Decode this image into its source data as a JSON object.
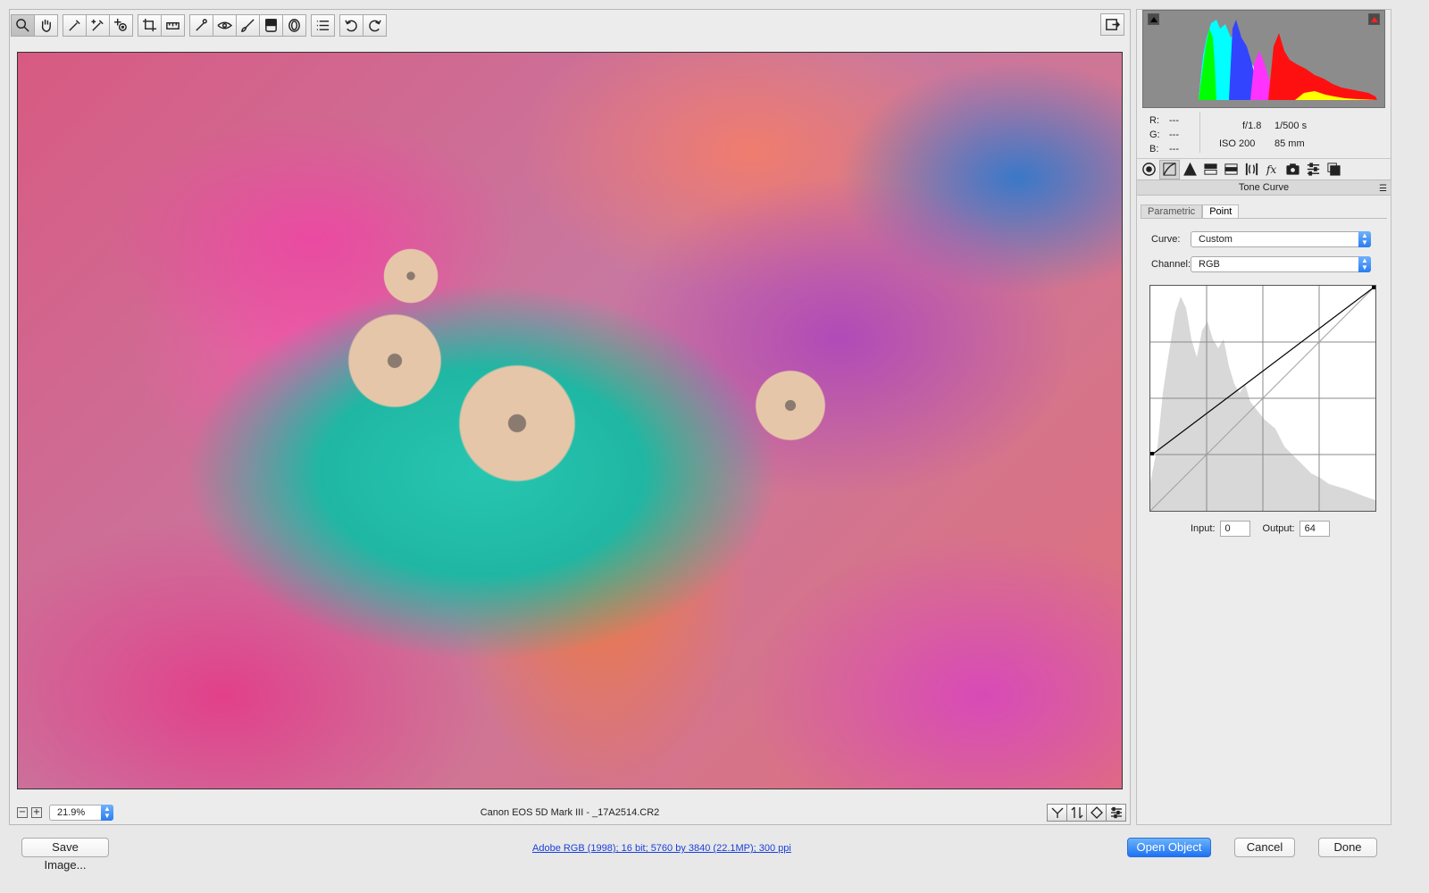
{
  "toolbar": {
    "tools": [
      "zoom-tool",
      "hand-tool",
      "white-balance-tool",
      "color-sampler-tool",
      "targeted-adjustment-tool",
      "crop-tool",
      "straighten-tool",
      "spot-removal-tool",
      "red-eye-tool",
      "adjustment-brush-tool",
      "graduated-filter-tool",
      "radial-filter-tool",
      "preferences-tool",
      "rotate-ccw-tool",
      "rotate-cw-tool"
    ]
  },
  "status_bar": {
    "zoom": "21.9%",
    "camera_info": "Canon EOS 5D Mark III  -  _17A2514.CR2"
  },
  "readout": {
    "r_label": "R:",
    "g_label": "G:",
    "b_label": "B:",
    "r_value": "---",
    "g_value": "---",
    "b_value": "---",
    "aperture": "f/1.8",
    "shutter": "1/500 s",
    "iso": "ISO 200",
    "focal": "85 mm"
  },
  "panel": {
    "title": "Tone Curve",
    "subtabs": [
      "Parametric",
      "Point"
    ],
    "curve_label": "Curve:",
    "curve_value": "Custom",
    "channel_label": "Channel:",
    "channel_value": "RGB",
    "input_label": "Input:",
    "input_value": "0",
    "output_label": "Output:",
    "output_value": "64"
  },
  "footer": {
    "save_label": "Save Image...",
    "workflow": "Adobe RGB (1998); 16 bit; 5760 by 3840 (22.1MP); 300 ppi",
    "open_label": "Open Object",
    "cancel_label": "Cancel",
    "done_label": "Done"
  },
  "colors": {
    "accent": "#2a7df0",
    "link": "#1a3fd8"
  }
}
